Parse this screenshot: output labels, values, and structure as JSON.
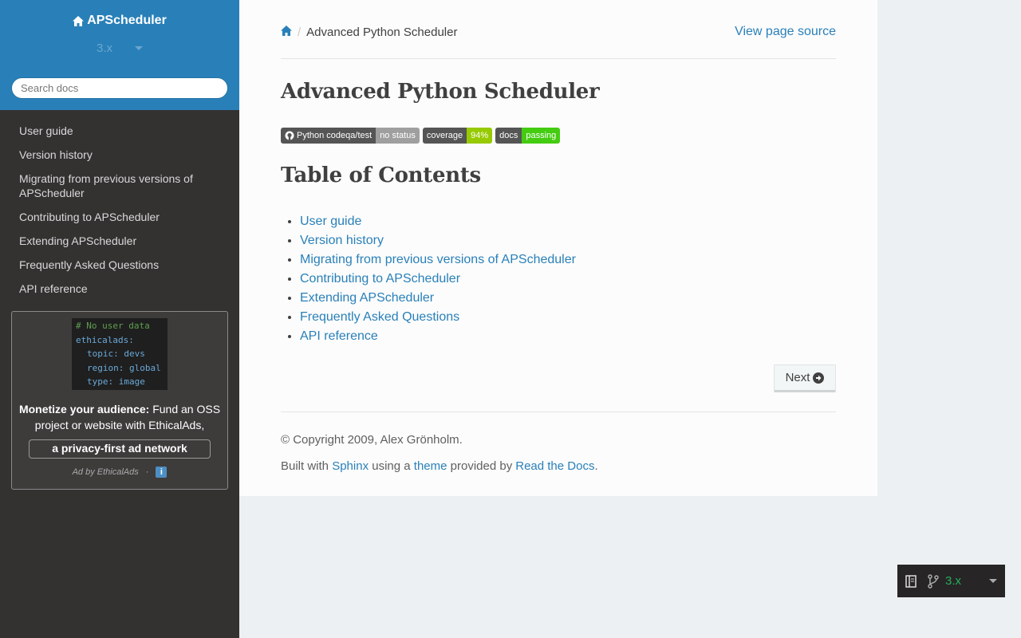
{
  "sidebar": {
    "project_name": "APScheduler",
    "version": "3.x",
    "search_placeholder": "Search docs",
    "nav": [
      "User guide",
      "Version history",
      "Migrating from previous versions of APScheduler",
      "Contributing to APScheduler",
      "Extending APScheduler",
      "Frequently Asked Questions",
      "API reference"
    ],
    "ad": {
      "code_lines": [
        "# No user data",
        "ethicalads:",
        "topic: devs",
        "region: global",
        "type: image"
      ],
      "headline": "Monetize your audience:",
      "body": "Fund an OSS project or website with EthicalAds,",
      "cta": "a privacy-first ad network",
      "footer": "Ad by EthicalAds",
      "separator": "·",
      "info": "i"
    }
  },
  "breadcrumbs": {
    "current": "Advanced Python Scheduler",
    "separator": "/",
    "view_source": "View page source"
  },
  "page": {
    "title": "Advanced Python Scheduler",
    "badges": [
      {
        "label": "Python codeqa/test",
        "value": "no status",
        "color": "#9f9f9f"
      },
      {
        "label": "coverage",
        "value": "94%",
        "color": "#97ca00"
      },
      {
        "label": "docs",
        "value": "passing",
        "color": "#4c1"
      }
    ],
    "toc_heading": "Table of Contents",
    "toc": [
      "User guide",
      "Version history",
      "Migrating from previous versions of APScheduler",
      "Contributing to APScheduler",
      "Extending APScheduler",
      "Frequently Asked Questions",
      "API reference"
    ],
    "next_label": "Next"
  },
  "footer": {
    "copyright": "© Copyright 2009, Alex Grönholm.",
    "built_prefix": "Built with",
    "sphinx": "Sphinx",
    "using_a": "using a",
    "theme": "theme",
    "provided_by": "provided by",
    "rtd": "Read the Docs",
    "period": "."
  },
  "rtd_badge": {
    "version": "3.x"
  },
  "colors": {
    "accent": "#2980b9",
    "sidebar": "#343131",
    "version_green": "#27ae60"
  }
}
